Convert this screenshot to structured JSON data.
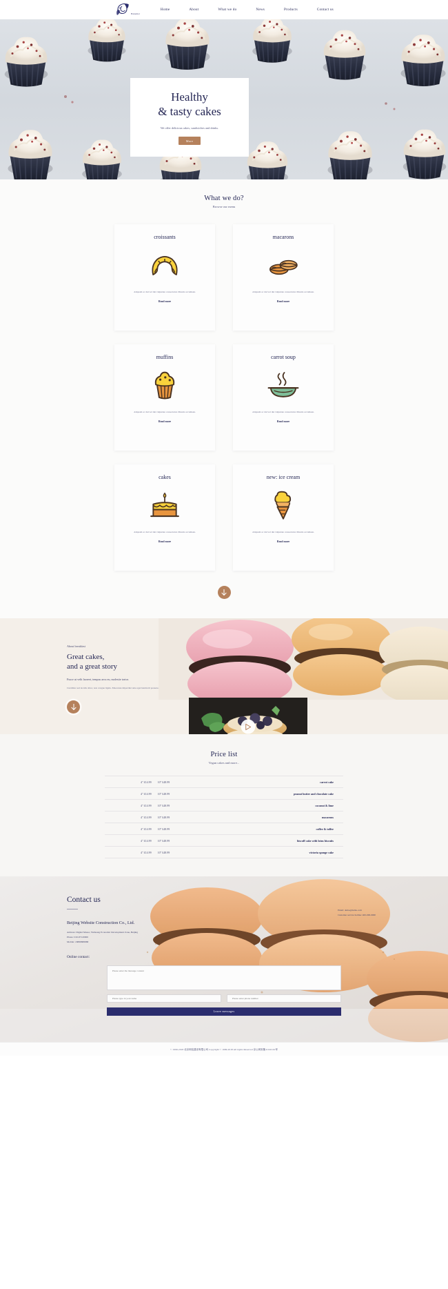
{
  "header": {
    "logo_text": "Bakemei",
    "nav": [
      {
        "label": "Home"
      },
      {
        "label": "About"
      },
      {
        "label": "What we do"
      },
      {
        "label": "News"
      },
      {
        "label": "Products"
      },
      {
        "label": "Contact us"
      }
    ]
  },
  "hero": {
    "title_line1": "Healthy",
    "title_line2": "& tasty cakes",
    "subtitle": "We offer delicious cakes, sandwiches and drinks.",
    "button_label": "More"
  },
  "menu": {
    "title": "What we do?",
    "subtitle": "Browse our menu",
    "cards": [
      {
        "title": "croissants",
        "icon": "croissant-icon",
        "desc": "Aliquam ac dui vel dui vulputate consectetur. Mauris accumsan.",
        "link": "Read more"
      },
      {
        "title": "macarons",
        "icon": "macaron-icon",
        "desc": "Aliquam ac dui vel dui vulputate consectetur. Mauris accumsan.",
        "link": "Read more"
      },
      {
        "title": "muffins",
        "icon": "muffin-icon",
        "desc": "Aliquam ac dui vel dui vulputate consectetur. Mauris accumsan.",
        "link": "Read more"
      },
      {
        "title": "carrot soup",
        "icon": "soup-bowl-icon",
        "desc": "Aliquam ac dui vel dui vulputate consectetur. Mauris accumsan.",
        "link": "Read more"
      },
      {
        "title": "cakes",
        "icon": "birthday-cake-icon",
        "desc": "Aliquam ac dui vel dui vulputate consectetur. Mauris accumsan.",
        "link": "Read more"
      },
      {
        "title": "new: ice cream",
        "icon": "ice-cream-cone-icon",
        "desc": "Aliquam ac dui vel dui vulputate consectetur. Mauris accumsan.",
        "link": "Read more"
      }
    ],
    "scroll_icon": "arrow-down-icon"
  },
  "about": {
    "kicker": "About breakfast",
    "heading_line1": "Great cakes,",
    "heading_line2": "and a great story",
    "paragraph1": "Fusce ut velit laoreet, tempus arcu eu, molestie tortor.",
    "paragraph2": "Curabitur sed iaculis dolor, non congue ligula. Maecenas imperdiet ante eget hendrerit posuere.",
    "arrow_icon": "arrow-down-icon",
    "play_icon": "play-icon"
  },
  "price_list": {
    "title": "Price list",
    "subtitle": "Vegan cakes and more...",
    "rows": [
      {
        "size_small": "4\" £14.99",
        "size_large": "10\" £48.99",
        "name": "carrot cake"
      },
      {
        "size_small": "4\" £14.99",
        "size_large": "10\" £48.99",
        "name": "peanut butter and chocolate cake"
      },
      {
        "size_small": "4\" £14.99",
        "size_large": "10\" £48.99",
        "name": "coconut & lime"
      },
      {
        "size_small": "4\" £14.99",
        "size_large": "10\" £48.99",
        "name": "macarons"
      },
      {
        "size_small": "4\" £14.99",
        "size_large": "10\" £48.99",
        "name": "coffee & toffee"
      },
      {
        "size_small": "4\" £14.99",
        "size_large": "10\" £48.99",
        "name": "biscoff cake with lotus biscuits"
      },
      {
        "size_small": "4\" £14.99",
        "size_large": "10\" £48.99",
        "name": "victoria sponge cake"
      }
    ]
  },
  "contact": {
    "heading": "Contact us",
    "company_name": "Beijing Website Construction Co., Ltd.",
    "address": "Address: Digital Manor, Yizhuang Economic Development Zone, Beijing",
    "phone": "Phone: 010-87120000",
    "mobile": "Mobile: 18888888888",
    "email": "Email: demo@demo.com",
    "hotline": "Customer service hotline: 400-000-0000",
    "online_heading": "Online contact:",
    "message_placeholder": "Please enter the message content",
    "name_placeholder": "Please type in your name",
    "phone_placeholder": "Please enter phone number",
    "submit_label": "Leave messages"
  },
  "footer": {
    "text": "© 1999-2018 北京网站建设有限公司 Copyright © 1999-2018 All rights Reserved    京公网安备11010101号"
  },
  "colors": {
    "navy": "#242654",
    "brown": "#b5815c",
    "cream": "#f4efe9",
    "footer_blue": "#2b2d6e"
  }
}
